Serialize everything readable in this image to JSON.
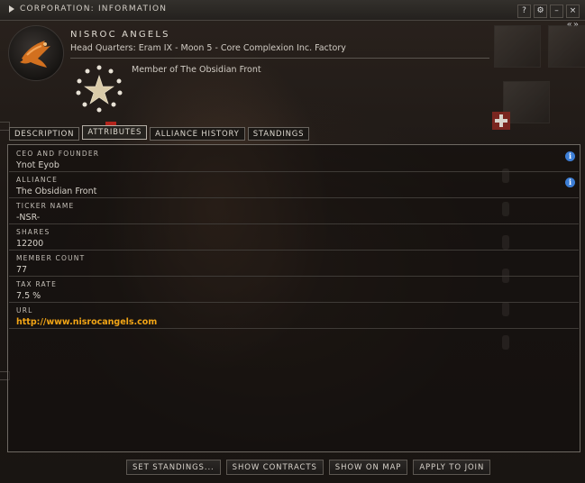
{
  "window": {
    "title": "CORPORATION: INFORMATION",
    "buttons": [
      "?",
      "⚙",
      "–",
      "×"
    ]
  },
  "corp": {
    "name": "NISROC ANGELS",
    "headquarters": "Head Quarters: Eram IX - Moon 5 - Core Complexion Inc. Factory",
    "membership": "Member of The Obsidian Front"
  },
  "side": {
    "arrows": "« »"
  },
  "tabs": [
    "DESCRIPTION",
    "ATTRIBUTES",
    "ALLIANCE HISTORY",
    "STANDINGS"
  ],
  "active_tab": "ATTRIBUTES",
  "attributes": [
    {
      "label": "CEO AND FOUNDER",
      "value": "Ynot Eyob",
      "info": true
    },
    {
      "label": "ALLIANCE",
      "value": "The Obsidian Front",
      "info": true
    },
    {
      "label": "TICKER NAME",
      "value": "-NSR-"
    },
    {
      "label": "SHARES",
      "value": "12200"
    },
    {
      "label": "MEMBER COUNT",
      "value": "77"
    },
    {
      "label": "TAX RATE",
      "value": "7.5 %"
    },
    {
      "label": "URL",
      "value": "http://www.nisrocangels.com",
      "link": true
    }
  ],
  "actions": [
    "SET STANDINGS...",
    "SHOW CONTRACTS",
    "SHOW ON MAP",
    "APPLY TO JOIN"
  ],
  "colors": {
    "link": "#f2a516",
    "info_icon": "#3d7ed6",
    "accent_red": "#b3241c"
  }
}
